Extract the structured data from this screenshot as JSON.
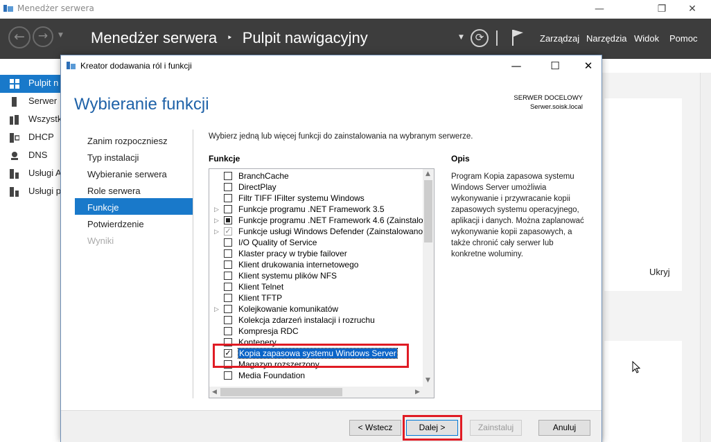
{
  "main_window": {
    "title": "Menedżer serwera",
    "breadcrumb_root": "Menedżer serwera",
    "breadcrumb_sep": "‣",
    "breadcrumb_page": "Pulpit nawigacyjny",
    "menu": [
      "Zarządzaj",
      "Narzędzia",
      "Widok",
      "Pomoc"
    ],
    "window_buttons": {
      "minimize": "—",
      "restore": "❐",
      "close": "✕"
    }
  },
  "left_nav": [
    {
      "label": "Pulpit n",
      "icon": "dashboard-icon",
      "selected": true
    },
    {
      "label": "Serwer",
      "icon": "server-icon"
    },
    {
      "label": "Wszystk",
      "icon": "servers-icon"
    },
    {
      "label": "DHCP",
      "icon": "dhcp-icon"
    },
    {
      "label": "DNS",
      "icon": "dns-icon"
    },
    {
      "label": "Usługi A",
      "icon": "services-icon"
    },
    {
      "label": "Usługi p",
      "icon": "services-icon"
    }
  ],
  "right_area": {
    "hide_label": "Ukryj"
  },
  "wizard": {
    "title": "Kreator dodawania ról i funkcji",
    "heading": "Wybieranie funkcji",
    "server_label": "SERWER DOCELOWY",
    "server_name": "Serwer.soisk.local",
    "steps": [
      {
        "label": "Zanim rozpoczniesz"
      },
      {
        "label": "Typ instalacji"
      },
      {
        "label": "Wybieranie serwera"
      },
      {
        "label": "Role serwera"
      },
      {
        "label": "Funkcje",
        "selected": true
      },
      {
        "label": "Potwierdzenie"
      },
      {
        "label": "Wyniki",
        "disabled": true
      }
    ],
    "instruction": "Wybierz jedną lub więcej funkcji do zainstalowania na wybranym serwerze.",
    "features_label": "Funkcje",
    "description_label": "Opis",
    "description": "Program Kopia zapasowa systemu Windows Server umożliwia wykonywanie i przywracanie kopii zapasowych systemu operacyjnego, aplikacji i danych. Można zaplanować wykonywanie kopii zapasowych, a także chronić cały serwer lub konkretne woluminy.",
    "features": [
      {
        "label": "BranchCache",
        "state": "unchecked"
      },
      {
        "label": "DirectPlay",
        "state": "unchecked"
      },
      {
        "label": "Filtr TIFF IFilter systemu Windows",
        "state": "unchecked"
      },
      {
        "label": "Funkcje programu .NET Framework 3.5",
        "state": "unchecked",
        "expandable": true
      },
      {
        "label": "Funkcje programu .NET Framework 4.6 (Zainstalow",
        "state": "partial",
        "expandable": true
      },
      {
        "label": "Funkcje usługi Windows Defender (Zainstalowano)",
        "state": "checked-gray",
        "expandable": true
      },
      {
        "label": "I/O Quality of Service",
        "state": "unchecked"
      },
      {
        "label": "Klaster pracy w trybie failover",
        "state": "unchecked"
      },
      {
        "label": "Klient drukowania internetowego",
        "state": "unchecked"
      },
      {
        "label": "Klient systemu plików NFS",
        "state": "unchecked"
      },
      {
        "label": "Klient Telnet",
        "state": "unchecked"
      },
      {
        "label": "Klient TFTP",
        "state": "unchecked"
      },
      {
        "label": "Kolejkowanie komunikatów",
        "state": "unchecked",
        "expandable": true
      },
      {
        "label": "Kolekcja zdarzeń instalacji i rozruchu",
        "state": "unchecked"
      },
      {
        "label": "Kompresja RDC",
        "state": "unchecked"
      },
      {
        "label": "Kontenery",
        "state": "unchecked"
      },
      {
        "label": "Kopia zapasowa systemu Windows Server",
        "state": "checked",
        "highlighted": true
      },
      {
        "label": "Magazyn rozszerzony",
        "state": "unchecked"
      },
      {
        "label": "Media Foundation",
        "state": "unchecked"
      }
    ],
    "buttons": {
      "back": "< Wstecz",
      "next": "Dalej >",
      "install": "Zainstaluj",
      "cancel": "Anuluj"
    },
    "window_buttons": {
      "minimize": "—",
      "maximize": "☐",
      "close": "✕"
    }
  },
  "colors": {
    "accent": "#1979ca",
    "header_bg": "#3d3d3d",
    "highlight_red": "#e01b24",
    "heading_blue": "#1f62a8"
  }
}
